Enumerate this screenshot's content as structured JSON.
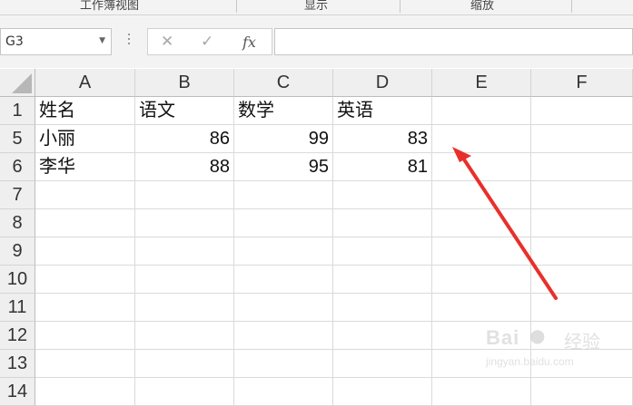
{
  "ribbon": {
    "groups": [
      "工作簿视图",
      "显示",
      "缩放"
    ]
  },
  "formula_bar": {
    "name_box": "G3",
    "cancel_icon": "✕",
    "enter_icon": "✓",
    "fx_label": "fx",
    "formula": ""
  },
  "sheet": {
    "columns": [
      "A",
      "B",
      "C",
      "D",
      "E",
      "F"
    ],
    "rows": [
      {
        "label": "1",
        "cells": [
          "姓名",
          "语文",
          "数学",
          "英语",
          "",
          ""
        ]
      },
      {
        "label": "5",
        "cells": [
          "小丽",
          "86",
          "99",
          "83",
          "",
          ""
        ]
      },
      {
        "label": "6",
        "cells": [
          "李华",
          "88",
          "95",
          "81",
          "",
          ""
        ]
      },
      {
        "label": "7",
        "cells": [
          "",
          "",
          "",
          "",
          "",
          ""
        ]
      },
      {
        "label": "8",
        "cells": [
          "",
          "",
          "",
          "",
          "",
          ""
        ]
      },
      {
        "label": "9",
        "cells": [
          "",
          "",
          "",
          "",
          "",
          ""
        ]
      },
      {
        "label": "10",
        "cells": [
          "",
          "",
          "",
          "",
          "",
          ""
        ]
      },
      {
        "label": "11",
        "cells": [
          "",
          "",
          "",
          "",
          "",
          ""
        ]
      },
      {
        "label": "12",
        "cells": [
          "",
          "",
          "",
          "",
          "",
          ""
        ]
      },
      {
        "label": "13",
        "cells": [
          "",
          "",
          "",
          "",
          "",
          ""
        ]
      },
      {
        "label": "14",
        "cells": [
          "",
          "",
          "",
          "",
          "",
          ""
        ]
      }
    ]
  },
  "annotation": {
    "arrow_color": "#e8302a"
  },
  "watermark": {
    "brand": "Bai",
    "brand_cn": "经验",
    "url": "jingyan.baidu.com"
  }
}
